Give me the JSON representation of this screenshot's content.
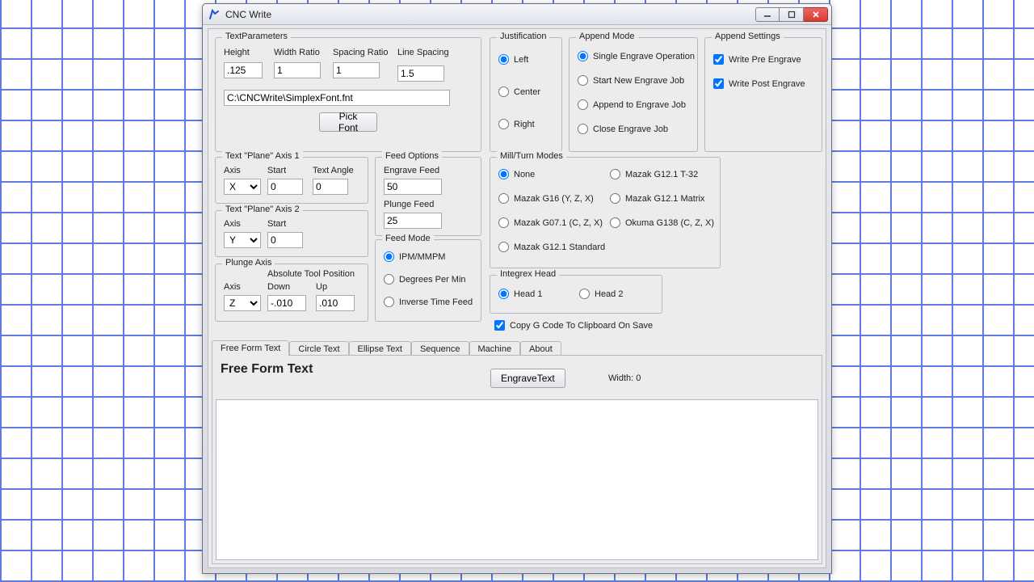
{
  "window": {
    "title": "CNC Write"
  },
  "textParams": {
    "legend": "TextParameters",
    "heightLabel": "Height",
    "height": ".125",
    "widthRatioLabel": "Width Ratio",
    "widthRatio": "1",
    "spacingRatioLabel": "Spacing Ratio",
    "spacingRatio": "1",
    "lineSpacingLabel": "Line Spacing",
    "lineSpacing": "1.5",
    "fontPath": "C:\\CNCWrite\\SimplexFont.fnt",
    "pickFont": "Pick Font"
  },
  "plane1": {
    "legend": "Text \"Plane\" Axis 1",
    "axisLabel": "Axis",
    "axis": "X",
    "startLabel": "Start",
    "start": "0",
    "angleLabel": "Text Angle",
    "angle": "0"
  },
  "plane2": {
    "legend": "Text \"Plane\" Axis 2",
    "axisLabel": "Axis",
    "axis": "Y",
    "startLabel": "Start",
    "start": "0"
  },
  "plunge": {
    "legend": "Plunge Axis",
    "axisLabel": "Axis",
    "axis": "Z",
    "atpLabel": "Absolute Tool Position",
    "downLabel": "Down",
    "down": "-.010",
    "upLabel": "Up",
    "up": ".010"
  },
  "feedOptions": {
    "legend": "Feed Options",
    "engraveLabel": "Engrave Feed",
    "engrave": "50",
    "plungeLabel": "Plunge Feed",
    "plunge": "25"
  },
  "feedMode": {
    "legend": "Feed Mode",
    "ipm": "IPM/MMPM",
    "dpm": "Degrees Per Min",
    "itf": "Inverse Time Feed"
  },
  "justification": {
    "legend": "Justification",
    "left": "Left",
    "center": "Center",
    "right": "Right"
  },
  "appendMode": {
    "legend": "Append Mode",
    "single": "Single Engrave Operation",
    "start": "Start New Engrave Job",
    "append": "Append to Engrave Job",
    "close": "Close Engrave Job"
  },
  "appendSettings": {
    "legend": "Append Settings",
    "pre": "Write Pre Engrave",
    "post": "Write Post Engrave"
  },
  "millTurn": {
    "legend": "Mill/Turn Modes",
    "none": "None",
    "g16": "Mazak G16  (Y, Z, X)",
    "g071": "Mazak G07.1 (C, Z, X)",
    "g121s": "Mazak G12.1 Standard",
    "g121t": "Mazak G12.1 T-32",
    "g121m": "Mazak G12.1 Matrix",
    "okuma": "Okuma G138  (C, Z, X)"
  },
  "integrex": {
    "legend": "Integrex Head",
    "h1": "Head 1",
    "h2": "Head 2"
  },
  "copyClipboard": "Copy G Code To Clipboard On Save",
  "tabs": {
    "free": "Free Form Text",
    "circle": "Circle Text",
    "ellipse": "Ellipse Text",
    "sequence": "Sequence",
    "machine": "Machine",
    "about": "About"
  },
  "freeForm": {
    "heading": "Free Form Text",
    "engraveBtn": "EngraveText",
    "widthLabel": "Width: 0"
  }
}
